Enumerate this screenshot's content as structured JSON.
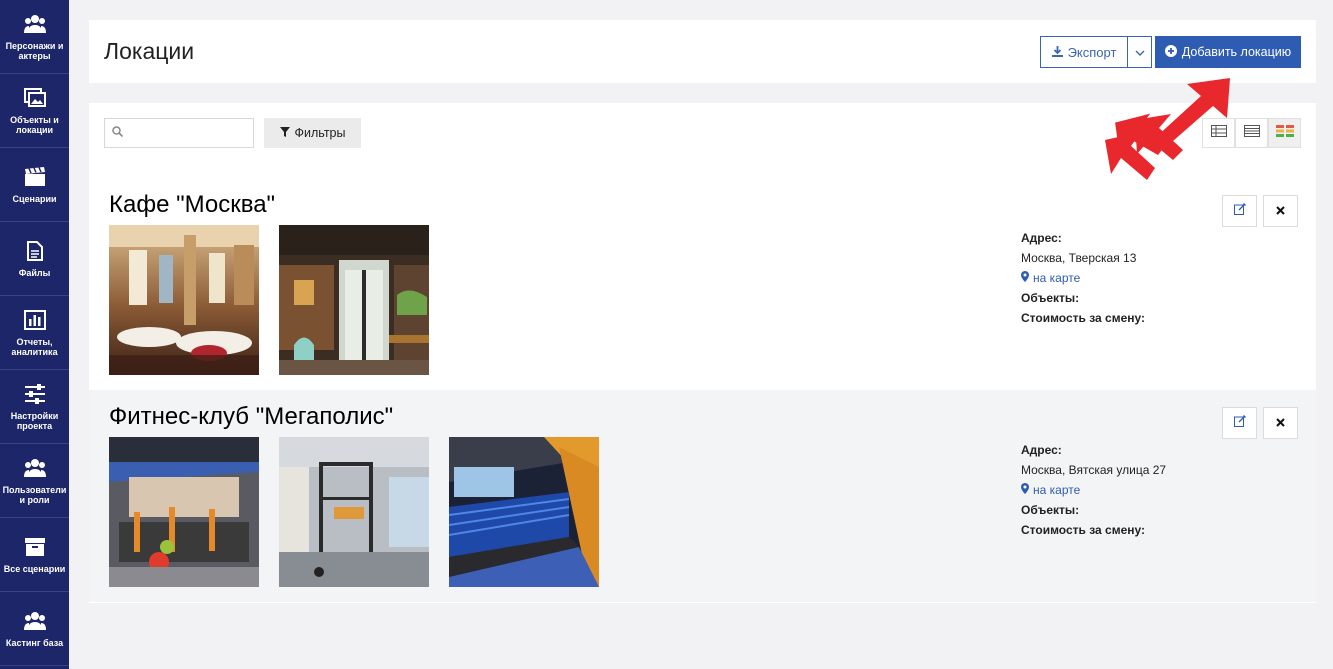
{
  "sidebar": {
    "items": [
      {
        "label": "Персонажи и актеры",
        "icon": "users-icon"
      },
      {
        "label": "Объекты и локации",
        "icon": "images-icon"
      },
      {
        "label": "Сценарии",
        "icon": "clapperboard-icon"
      },
      {
        "label": "Файлы",
        "icon": "file-icon"
      },
      {
        "label": "Отчеты, аналитика",
        "icon": "bar-chart-icon"
      },
      {
        "label": "Настройки проекта",
        "icon": "sliders-icon"
      },
      {
        "label": "Пользователи и роли",
        "icon": "users-icon"
      },
      {
        "label": "Все сценарии",
        "icon": "archive-icon"
      },
      {
        "label": "Кастинг база",
        "icon": "users-icon"
      }
    ]
  },
  "header": {
    "title": "Локации",
    "export_label": "Экспорт",
    "add_label": "Добавить локацию"
  },
  "toolbar": {
    "search_placeholder": "",
    "filter_label": "Фильтры"
  },
  "colors": {
    "sidebar": "#1d2669",
    "accent": "#2f5cb3",
    "arrow": "#e8282d"
  },
  "locations": [
    {
      "name": "Кафе \"Москва\"",
      "address_label": "Адрес:",
      "address": "Москва, Тверская 13",
      "map_label": "на карте",
      "objects_label": "Объекты:",
      "cost_label": "Стоимость за смену:",
      "photos": [
        "restaurant-hall-photo",
        "cafe-entrance-photo"
      ]
    },
    {
      "name": "Фитнес-клуб \"Мегаполис\"",
      "address_label": "Адрес:",
      "address": "Москва, Вятская улица 27",
      "map_label": "на карте",
      "objects_label": "Объекты:",
      "cost_label": "Стоимость за смену:",
      "photos": [
        "gym-floor-photo",
        "gym-rig-photo",
        "gym-corridor-photo"
      ]
    }
  ]
}
